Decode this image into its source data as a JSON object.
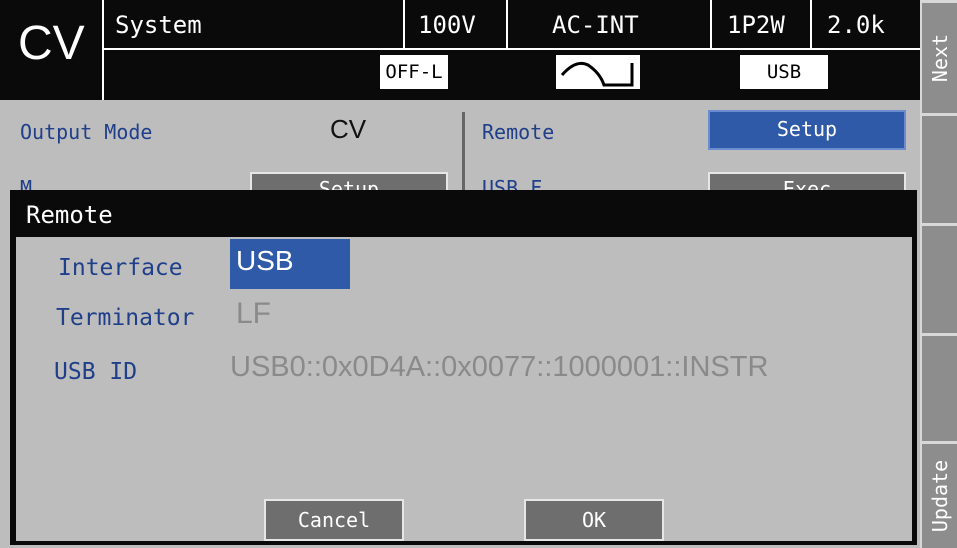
{
  "header": {
    "mode": "CV",
    "screen": "System",
    "voltage_range": "100V",
    "source": "AC-INT",
    "wiring": "1P2W",
    "value": "2.0k",
    "output_state": "OFF-L",
    "waveform_icon": "ac-sine-square-icon",
    "interface_indicator": "USB"
  },
  "main": {
    "output_mode_label": "Output Mode",
    "output_mode_value": "CV",
    "remote_label": "Remote",
    "remote_button": "Setup",
    "partial_left_label": "M",
    "partial_left_button": "Setup",
    "partial_right_label": "USB F",
    "partial_right_button": "Exec"
  },
  "softkeys": {
    "top": "Next",
    "bottom": "Update"
  },
  "dialog": {
    "title": "Remote",
    "interface_label": "Interface",
    "interface_value": "USB",
    "terminator_label": "Terminator",
    "terminator_value": "LF",
    "usb_id_label": "USB ID",
    "usb_id_value": "USB0::0x0D4A::0x0077::1000001::INSTR",
    "cancel_label": "Cancel",
    "ok_label": "OK"
  },
  "colors": {
    "header_bg": "#0a0a0a",
    "accent_blue": "#2f5aa8",
    "label_blue": "#1f3f8a",
    "panel_grey": "#bdbdbd"
  }
}
